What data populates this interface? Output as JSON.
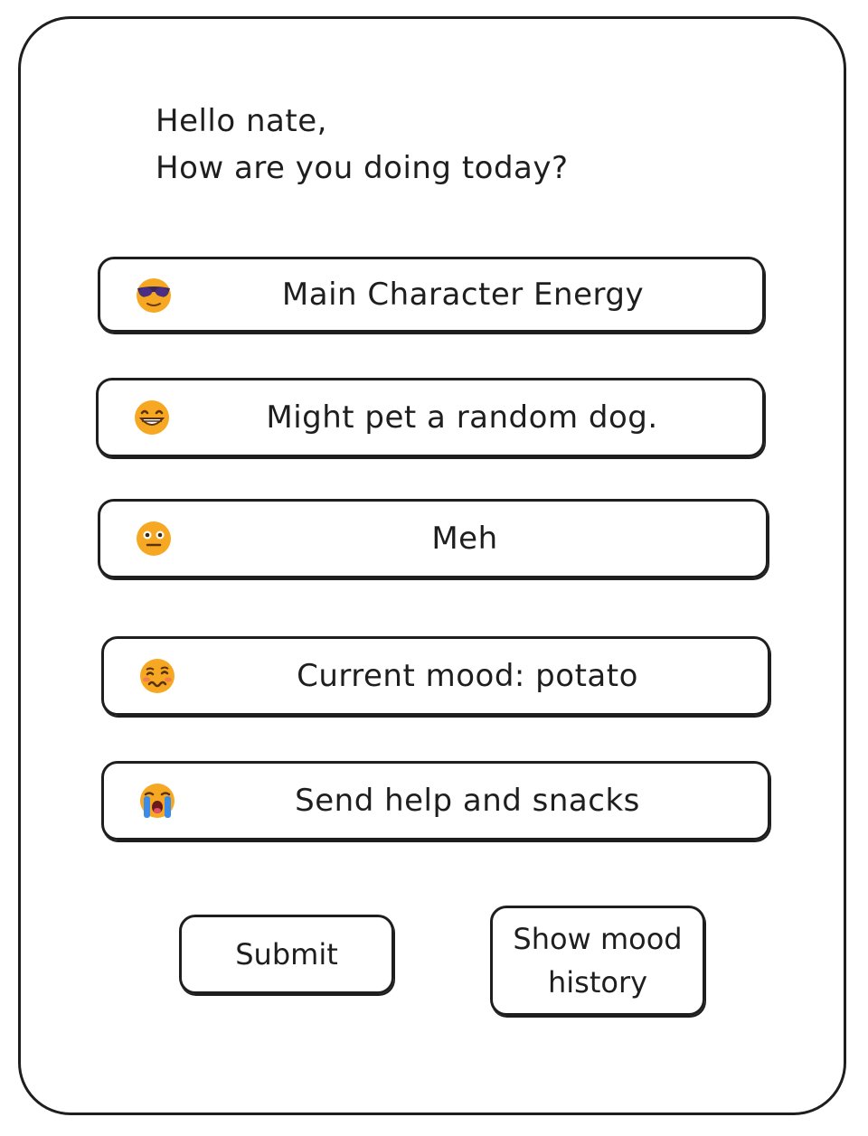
{
  "greeting": {
    "line1": "Hello nate,",
    "line2": "How are you doing today?"
  },
  "moods": [
    {
      "label": "Main Character Energy",
      "icon": "sunglasses-face-icon"
    },
    {
      "label": "Might pet a random dog.",
      "icon": "grinning-face-icon"
    },
    {
      "label": "Meh",
      "icon": "neutral-face-icon"
    },
    {
      "label": "Current mood: potato",
      "icon": "woozy-face-icon"
    },
    {
      "label": "Send help and snacks",
      "icon": "crying-face-icon"
    }
  ],
  "actions": {
    "submit_label": "Submit",
    "history_label": "Show mood history"
  },
  "colors": {
    "ink": "#1e1e1e",
    "emoji_yellow": "#f7a823"
  }
}
